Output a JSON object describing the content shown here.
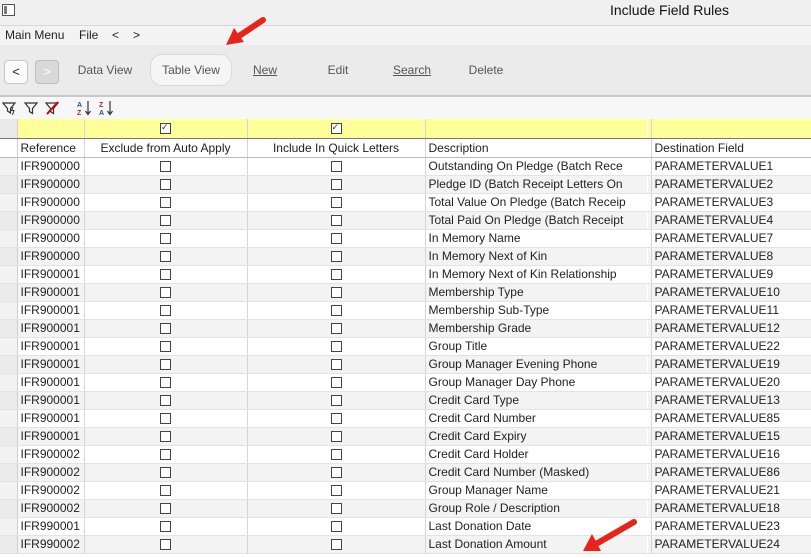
{
  "window": {
    "title": "Include Field Rules"
  },
  "menu": {
    "main": "Main Menu",
    "file": "File",
    "back": "<",
    "forward": ">"
  },
  "toolbar": {
    "back": "<",
    "forward": ">",
    "data_view": "Data View",
    "table_view": "Table View",
    "new": "New",
    "edit": "Edit",
    "search": "Search",
    "delete": "Delete"
  },
  "filter_row": {
    "exclude_checked": true,
    "quick_letters_checked": true
  },
  "table": {
    "columns": [
      "Reference",
      "Exclude from Auto Apply",
      "Include In Quick Letters",
      "Description",
      "Destination Field"
    ],
    "rows": [
      {
        "ref": "IFR900000",
        "desc": "Outstanding On Pledge (Batch Rece",
        "dest": "PARAMETERVALUE1"
      },
      {
        "ref": "IFR900000",
        "desc": "Pledge ID (Batch Receipt Letters On",
        "dest": "PARAMETERVALUE2"
      },
      {
        "ref": "IFR900000",
        "desc": "Total Value On Pledge (Batch Receip",
        "dest": "PARAMETERVALUE3"
      },
      {
        "ref": "IFR900000",
        "desc": "Total Paid On Pledge (Batch Receipt",
        "dest": "PARAMETERVALUE4"
      },
      {
        "ref": "IFR900000",
        "desc": "In Memory Name",
        "dest": "PARAMETERVALUE7"
      },
      {
        "ref": "IFR900000",
        "desc": "In Memory Next of Kin",
        "dest": "PARAMETERVALUE8"
      },
      {
        "ref": "IFR900001",
        "desc": "In Memory Next of Kin Relationship",
        "dest": "PARAMETERVALUE9"
      },
      {
        "ref": "IFR900001",
        "desc": "Membership Type",
        "dest": "PARAMETERVALUE10"
      },
      {
        "ref": "IFR900001",
        "desc": "Membership Sub-Type",
        "dest": "PARAMETERVALUE11"
      },
      {
        "ref": "IFR900001",
        "desc": "Membership Grade",
        "dest": "PARAMETERVALUE12"
      },
      {
        "ref": "IFR900001",
        "desc": "Group Title",
        "dest": "PARAMETERVALUE22"
      },
      {
        "ref": "IFR900001",
        "desc": "Group Manager Evening Phone",
        "dest": "PARAMETERVALUE19"
      },
      {
        "ref": "IFR900001",
        "desc": "Group Manager Day Phone",
        "dest": "PARAMETERVALUE20"
      },
      {
        "ref": "IFR900001",
        "desc": "Credit Card Type",
        "dest": "PARAMETERVALUE13"
      },
      {
        "ref": "IFR900001",
        "desc": "Credit Card Number",
        "dest": "PARAMETERVALUE85"
      },
      {
        "ref": "IFR900001",
        "desc": "Credit Card Expiry",
        "dest": "PARAMETERVALUE15"
      },
      {
        "ref": "IFR900002",
        "desc": "Credit Card Holder",
        "dest": "PARAMETERVALUE16"
      },
      {
        "ref": "IFR900002",
        "desc": "Credit Card Number (Masked)",
        "dest": "PARAMETERVALUE86"
      },
      {
        "ref": "IFR900002",
        "desc": "Group Manager Name",
        "dest": "PARAMETERVALUE21"
      },
      {
        "ref": "IFR900002",
        "desc": "Group Role / Description",
        "dest": "PARAMETERVALUE18"
      },
      {
        "ref": "IFR990001",
        "desc": "Last Donation Date",
        "dest": "PARAMETERVALUE23"
      },
      {
        "ref": "IFR990002",
        "desc": "Last Donation Amount",
        "dest": "PARAMETERVALUE24"
      }
    ]
  }
}
